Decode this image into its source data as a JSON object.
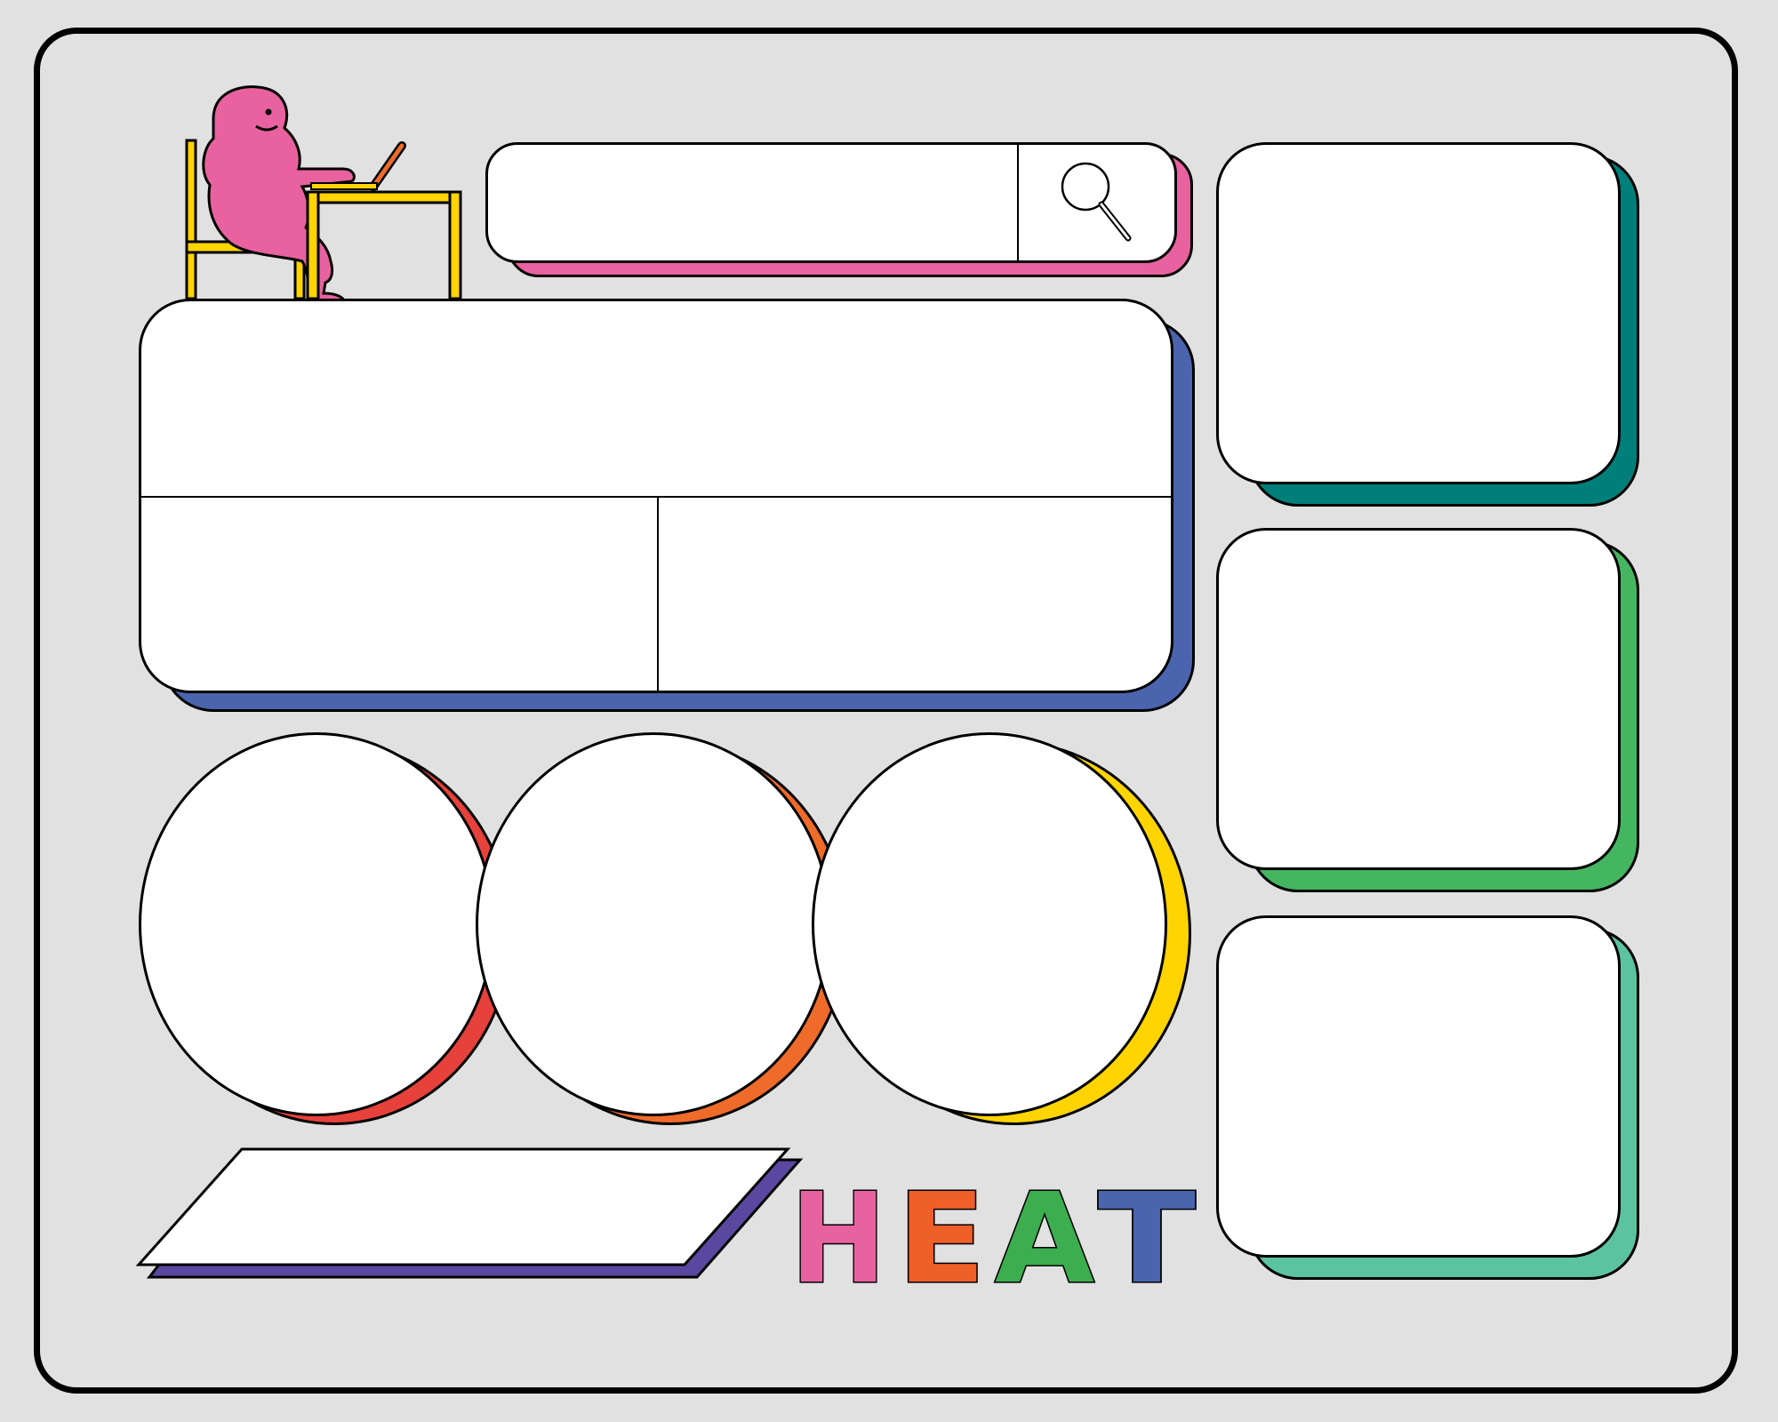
{
  "colors": {
    "background": "#e1e1e1",
    "frame": "#000000",
    "search_shadow": "#e8629f",
    "main_shadow": "#4a64ad",
    "card1_shadow": "#007f7a",
    "card2_shadow": "#45b660",
    "card3_shadow": "#5cc3a0",
    "circle1_shadow": "#e6413b",
    "circle2_shadow": "#ef6b2a",
    "circle3_shadow": "#ffd400",
    "parallelogram_shadow": "#5a48a0",
    "heat_h": "#e8629f",
    "heat_e": "#ef5f28",
    "heat_a": "#3cae50",
    "heat_t": "#4a64ad",
    "character": "#e8629f",
    "furniture": "#ffd400"
  },
  "illustration": {
    "icon": "person-at-desk-icon"
  },
  "search": {
    "placeholder": "",
    "value": "",
    "icon": "search-icon"
  },
  "heading": {
    "text": "HEAT",
    "letters": [
      "H",
      "E",
      "A",
      "T"
    ]
  }
}
